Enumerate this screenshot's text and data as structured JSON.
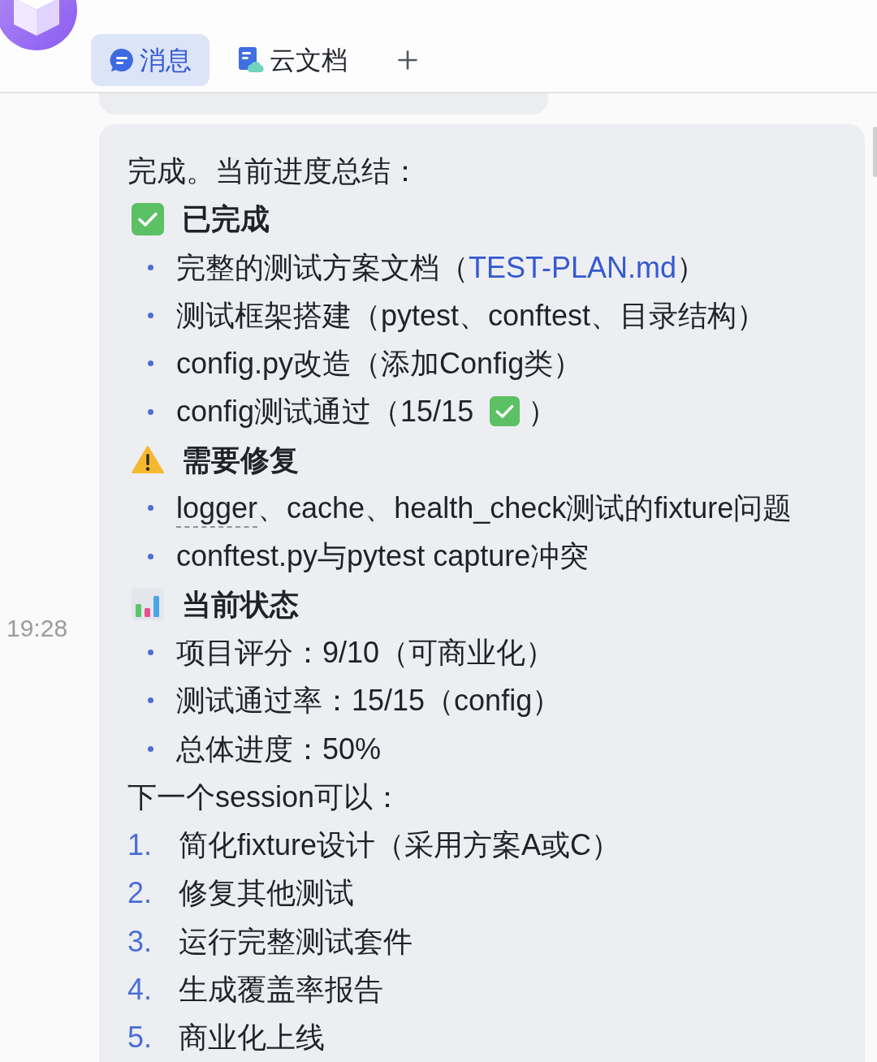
{
  "tabs": [
    {
      "label": "消息",
      "kind": "chat",
      "selected": true
    },
    {
      "label": "云文档",
      "kind": "doc",
      "selected": false
    }
  ],
  "message": {
    "time": "19:28",
    "intro": "完成。当前进度总结：",
    "sections": [
      {
        "kind": "done",
        "title": "已完成",
        "items": [
          {
            "parts": [
              {
                "kind": "text",
                "text": "完整的测试方案文档（"
              },
              {
                "kind": "link",
                "text": "TEST-PLAN.md"
              },
              {
                "kind": "text",
                "text": "）"
              }
            ]
          },
          {
            "parts": [
              {
                "kind": "text",
                "text": "测试框架搭建（pytest、conftest、目录结构）"
              }
            ]
          },
          {
            "parts": [
              {
                "kind": "text",
                "text": "config.py改造（添加Config类）"
              }
            ]
          },
          {
            "parts": [
              {
                "kind": "text",
                "text": "config测试通过（15/15"
              },
              {
                "kind": "check"
              },
              {
                "kind": "text",
                "text": "）"
              }
            ]
          }
        ]
      },
      {
        "kind": "warning",
        "title": "需要修复",
        "items": [
          {
            "parts": [
              {
                "kind": "term",
                "text": "logger"
              },
              {
                "kind": "text",
                "text": "、cache、health_check测试的fixture问题"
              }
            ]
          },
          {
            "parts": [
              {
                "kind": "text",
                "text": "conftest.py与pytest capture冲突"
              }
            ]
          }
        ]
      },
      {
        "kind": "status",
        "title": "当前状态",
        "items": [
          {
            "parts": [
              {
                "kind": "text",
                "text": "项目评分：9/10（可商业化）"
              }
            ]
          },
          {
            "parts": [
              {
                "kind": "text",
                "text": "测试通过率：15/15（config）"
              }
            ]
          },
          {
            "parts": [
              {
                "kind": "text",
                "text": "总体进度：50%"
              }
            ]
          }
        ]
      }
    ],
    "next_title": "下一个session可以：",
    "steps": [
      {
        "number": "1.",
        "text": "简化fixture设计（采用方案A或C）"
      },
      {
        "number": "2.",
        "text": "修复其他测试"
      },
      {
        "number": "3.",
        "text": "运行完整测试套件"
      },
      {
        "number": "4.",
        "text": "生成覆盖率报告"
      },
      {
        "number": "5.",
        "text": "商业化上线"
      }
    ]
  }
}
